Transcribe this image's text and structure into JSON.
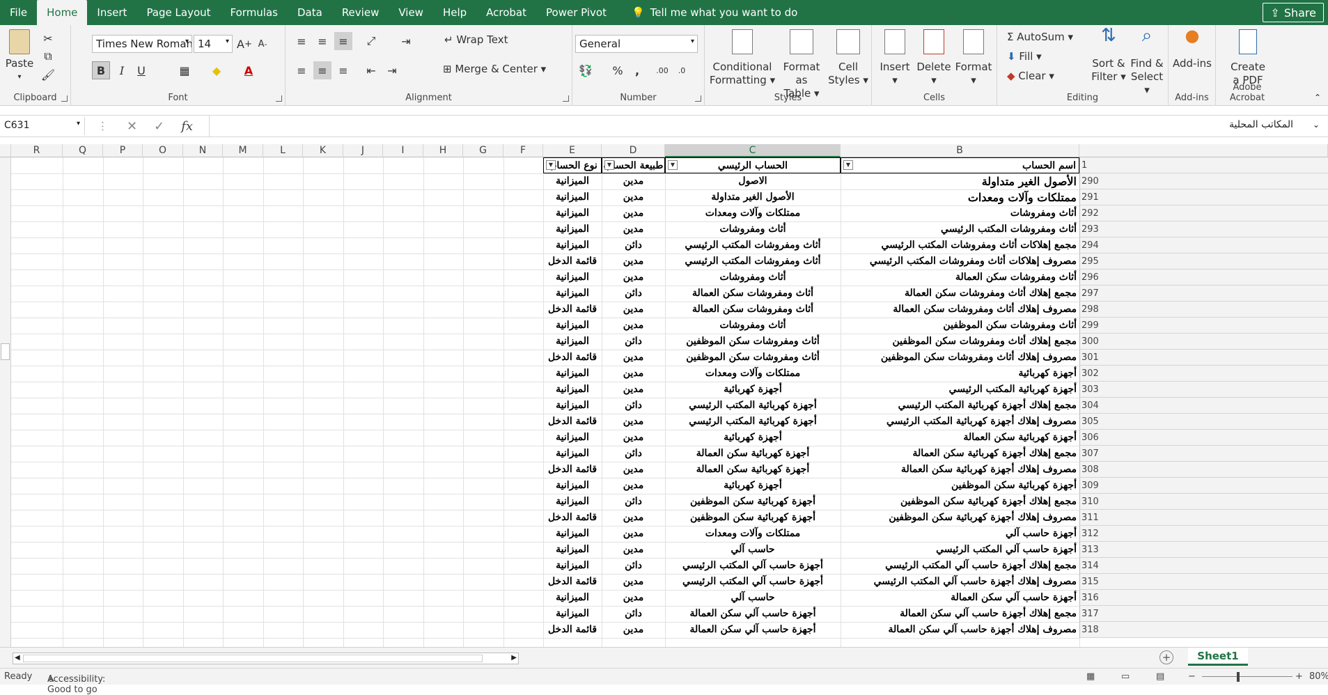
{
  "menu": {
    "tabs": [
      "File",
      "Home",
      "Insert",
      "Page Layout",
      "Formulas",
      "Data",
      "Review",
      "View",
      "Help",
      "Acrobat",
      "Power Pivot"
    ],
    "active": "Home",
    "tell_me": "Tell me what you want to do",
    "share": "Share"
  },
  "ribbon": {
    "clipboard": {
      "paste": "Paste",
      "label": "Clipboard"
    },
    "font": {
      "name": "Times New Roman",
      "size": "14",
      "label": "Font",
      "bold": "B",
      "italic": "I",
      "underline": "U"
    },
    "alignment": {
      "wrap": "Wrap Text",
      "merge": "Merge & Center",
      "label": "Alignment"
    },
    "number": {
      "format": "General",
      "label": "Number",
      "percent": "%",
      "comma": ","
    },
    "styles": {
      "conditional": "Conditional",
      "conditional2": "Formatting",
      "format_as": "Format as",
      "format_as2": "Table",
      "cell": "Cell",
      "cell2": "Styles",
      "label": "Styles"
    },
    "cells": {
      "insert": "Insert",
      "delete": "Delete",
      "format": "Format",
      "label": "Cells"
    },
    "editing": {
      "autosum": "AutoSum",
      "fill": "Fill",
      "clear": "Clear",
      "sort": "Sort &",
      "sort2": "Filter",
      "find": "Find &",
      "find2": "Select",
      "label": "Editing"
    },
    "addins": {
      "addins": "Add-ins",
      "label": "Add-ins"
    },
    "acrobat": {
      "create": "Create",
      "create2": "a PDF",
      "label": "Adobe Acrobat"
    }
  },
  "formula_bar": {
    "name_box": "C631",
    "fx": "fx",
    "content": "المكاتب المحلية"
  },
  "columns": [
    "R",
    "Q",
    "P",
    "O",
    "N",
    "M",
    "L",
    "K",
    "J",
    "I",
    "H",
    "G",
    "F",
    "E",
    "D",
    "C",
    "B"
  ],
  "table_headers": {
    "B": "اسم الحساب",
    "C": "الحساب الرئيسي",
    "D": "طبيعة الحساب",
    "E": "نوع الحساب"
  },
  "rows": [
    {
      "n": "1",
      "b": "",
      "c": "",
      "d": "",
      "e": ""
    },
    {
      "n": "290",
      "b": "الأصول الغير متداولة",
      "c": "الاصول",
      "d": "مدين",
      "e": "الميزانية"
    },
    {
      "n": "291",
      "b": "ممتلكات وآلات ومعدات",
      "c": "الأصول الغير متداولة",
      "d": "مدين",
      "e": "الميزانية"
    },
    {
      "n": "292",
      "b": "أثاث ومفروشات",
      "c": "ممتلكات وآلات ومعدات",
      "d": "مدين",
      "e": "الميزانية"
    },
    {
      "n": "293",
      "b": "أثاث ومفروشات المكتب الرئيسي",
      "c": "أثاث ومفروشات",
      "d": "مدين",
      "e": "الميزانية"
    },
    {
      "n": "294",
      "b": "مجمع إهلاكات أثاث ومفروشات المكتب الرئيسي",
      "c": "أثاث ومفروشات المكتب الرئيسي",
      "d": "دائن",
      "e": "الميزانية"
    },
    {
      "n": "295",
      "b": "مصروف إهلاكات أثاث ومفروشات المكتب الرئيسي",
      "c": "أثاث ومفروشات المكتب الرئيسي",
      "d": "مدين",
      "e": "قائمة الدخل"
    },
    {
      "n": "296",
      "b": "أثاث ومفروشات سكن العمالة",
      "c": "أثاث ومفروشات",
      "d": "مدين",
      "e": "الميزانية"
    },
    {
      "n": "297",
      "b": "مجمع إهلاك أثاث ومفروشات سكن العمالة",
      "c": "أثاث ومفروشات سكن العمالة",
      "d": "دائن",
      "e": "الميزانية"
    },
    {
      "n": "298",
      "b": "مصروف إهلاك أثاث ومفروشات سكن العمالة",
      "c": "أثاث ومفروشات سكن العمالة",
      "d": "مدين",
      "e": "قائمة الدخل"
    },
    {
      "n": "299",
      "b": "أثاث ومفروشات سكن الموظفين",
      "c": "أثاث ومفروشات",
      "d": "مدين",
      "e": "الميزانية"
    },
    {
      "n": "300",
      "b": "مجمع إهلاك أثاث ومفروشات سكن الموظفين",
      "c": "أثاث ومفروشات سكن الموظفين",
      "d": "دائن",
      "e": "الميزانية"
    },
    {
      "n": "301",
      "b": "مصروف إهلاك أثاث ومفروشات سكن الموظفين",
      "c": "أثاث ومفروشات سكن الموظفين",
      "d": "مدين",
      "e": "قائمة الدخل"
    },
    {
      "n": "302",
      "b": "أجهزة كهربائية",
      "c": "ممتلكات وآلات ومعدات",
      "d": "مدين",
      "e": "الميزانية"
    },
    {
      "n": "303",
      "b": "أجهزة كهربائية المكتب الرئيسي",
      "c": "أجهزة كهربائية",
      "d": "مدين",
      "e": "الميزانية"
    },
    {
      "n": "304",
      "b": "مجمع إهلاك أجهزة كهربائية المكتب الرئيسي",
      "c": "أجهزة كهربائية المكتب الرئيسي",
      "d": "دائن",
      "e": "الميزانية"
    },
    {
      "n": "305",
      "b": "مصروف إهلاك أجهزة كهربائية المكتب الرئيسي",
      "c": "أجهزة كهربائية المكتب الرئيسي",
      "d": "مدين",
      "e": "قائمة الدخل"
    },
    {
      "n": "306",
      "b": "أجهزة كهربائية سكن العمالة",
      "c": "أجهزة كهربائية",
      "d": "مدين",
      "e": "الميزانية"
    },
    {
      "n": "307",
      "b": "مجمع إهلاك أجهزة كهربائية سكن العمالة",
      "c": "أجهزة كهربائية سكن العمالة",
      "d": "دائن",
      "e": "الميزانية"
    },
    {
      "n": "308",
      "b": "مصروف إهلاك أجهزة كهربائية سكن العمالة",
      "c": "أجهزة كهربائية سكن العمالة",
      "d": "مدين",
      "e": "قائمة الدخل"
    },
    {
      "n": "309",
      "b": "أجهزة كهربائية سكن الموظفين",
      "c": "أجهزة كهربائية",
      "d": "مدين",
      "e": "الميزانية"
    },
    {
      "n": "310",
      "b": "مجمع إهلاك أجهزة كهربائية سكن الموظفين",
      "c": "أجهزة كهربائية سكن الموظفين",
      "d": "دائن",
      "e": "الميزانية"
    },
    {
      "n": "311",
      "b": "مصروف إهلاك أجهزة كهربائية سكن الموظفين",
      "c": "أجهزة كهربائية سكن الموظفين",
      "d": "مدين",
      "e": "قائمة الدخل"
    },
    {
      "n": "312",
      "b": "أجهزة حاسب آلي",
      "c": "ممتلكات وآلات ومعدات",
      "d": "مدين",
      "e": "الميزانية"
    },
    {
      "n": "313",
      "b": "أجهزة حاسب آلي المكتب الرئيسي",
      "c": "حاسب آلي",
      "d": "مدين",
      "e": "الميزانية"
    },
    {
      "n": "314",
      "b": "مجمع إهلاك أجهزة حاسب آلي المكتب الرئيسي",
      "c": "أجهزة حاسب آلي المكتب الرئيسي",
      "d": "دائن",
      "e": "الميزانية"
    },
    {
      "n": "315",
      "b": "مصروف إهلاك أجهزة حاسب آلي المكتب الرئيسي",
      "c": "أجهزة حاسب آلي المكتب الرئيسي",
      "d": "مدين",
      "e": "قائمة الدخل"
    },
    {
      "n": "316",
      "b": "أجهزة  حاسب آلي سكن العمالة",
      "c": "حاسب آلي",
      "d": "مدين",
      "e": "الميزانية"
    },
    {
      "n": "317",
      "b": "مجمع إهلاك أجهزة حاسب آلي سكن العمالة",
      "c": "أجهزة  حاسب آلي سكن العمالة",
      "d": "دائن",
      "e": "الميزانية"
    },
    {
      "n": "318",
      "b": "مصروف إهلاك أجهزة حاسب آلي سكن العمالة",
      "c": "أجهزة  حاسب آلي سكن العمالة",
      "d": "مدين",
      "e": "قائمة الدخل"
    }
  ],
  "sheet_tab": "Sheet1",
  "status": {
    "ready": "Ready",
    "accessibility": "Accessibility: Good to go",
    "zoom": "80%"
  },
  "colors": {
    "accent": "#217346"
  }
}
